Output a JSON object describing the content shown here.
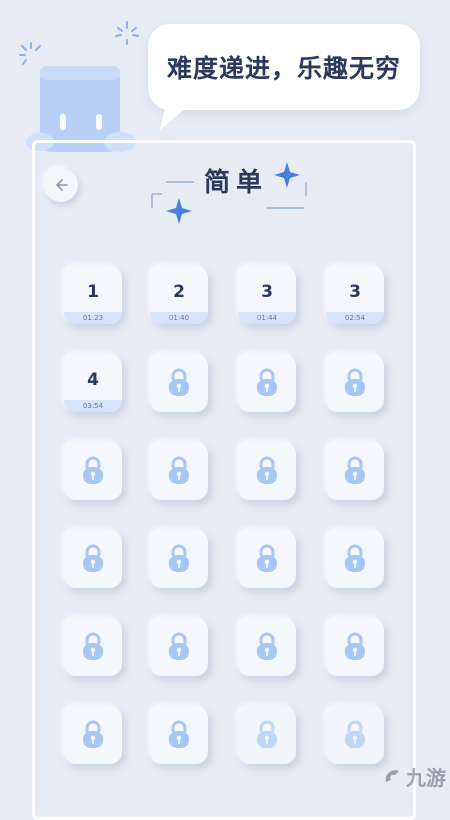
{
  "header": {
    "bubble_text": "难度递进，乐趣无穷"
  },
  "page": {
    "title": "简单",
    "back_icon": "arrow-left-icon"
  },
  "levels": [
    {
      "label": "1",
      "time": "01:23",
      "locked": false
    },
    {
      "label": "2",
      "time": "01:40",
      "locked": false
    },
    {
      "label": "3",
      "time": "01:44",
      "locked": false
    },
    {
      "label": "3",
      "time": "02:54",
      "locked": false
    },
    {
      "label": "4",
      "time": "03:54",
      "locked": false
    },
    {
      "locked": true
    },
    {
      "locked": true
    },
    {
      "locked": true
    },
    {
      "locked": true
    },
    {
      "locked": true
    },
    {
      "locked": true
    },
    {
      "locked": true
    },
    {
      "locked": true
    },
    {
      "locked": true
    },
    {
      "locked": true
    },
    {
      "locked": true
    },
    {
      "locked": true
    },
    {
      "locked": true
    },
    {
      "locked": true
    },
    {
      "locked": true
    },
    {
      "locked": true
    },
    {
      "locked": true
    },
    {
      "locked": true
    },
    {
      "locked": true
    }
  ],
  "colors": {
    "background": "#e7ebf3",
    "accent": "#4a7fe0",
    "lock": "#a9c7f3",
    "text": "#2b3a5c"
  },
  "watermark": {
    "text": "九游",
    "icon": "jiuyou-logo-icon"
  }
}
